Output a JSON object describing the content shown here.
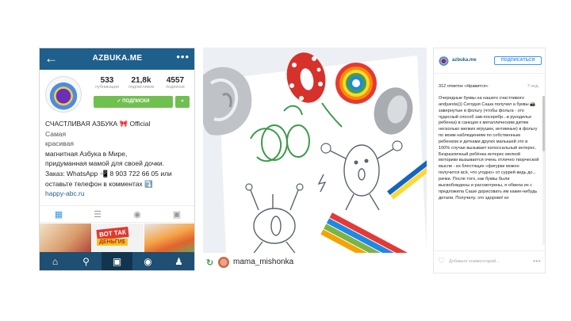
{
  "left_profile": {
    "header": {
      "username": "AZBUKA.ME",
      "back_icon": "arrow-left-icon",
      "more_icon": "more-dots-icon"
    },
    "stats": [
      {
        "value": "533",
        "label": "публикации"
      },
      {
        "value": "21,8k",
        "label": "подписчиков"
      },
      {
        "value": "4557",
        "label": "подписки"
      }
    ],
    "follow_button": "✓ ПОДПИСКИ",
    "bio": {
      "name": "СЧАСТЛИВАЯ АЗБУКА 🎀 Official",
      "line2": "Самая",
      "line3": "красивая",
      "line4": "магнитная Азбука в Мире,",
      "line5": "придуманная мамой для своей дочки.",
      "line6": "Заказ: WhatsApp 📲 8 903 722 66 05 или",
      "line7": "оставьте телефон в комментах ⤵️",
      "link": "happy-abc.ru"
    },
    "thumb2": {
      "line1": "ВОТ ТАК",
      "line2": "ДЕНЬГИ$"
    },
    "accent_color": "#1f5f8b"
  },
  "photo": {
    "repost_user": "mama_mishonka"
  },
  "right_post": {
    "username": "azbuka.me",
    "subscribe_button": "ПОДПИСАТЬСЯ",
    "likes": "312 отметок «Нравится»",
    "time": "7 нед.",
    "text": "Очередные буквы на нашего счастливого andjuesta))) Сегодня Саша получил а буквы 📸 завернутые в фольгу (чтобы фольга - это чудесный способ зав-посеребр...в рукоделье ребенка) в санкция к металлическим дитям несколько мелких игрушек, интимные) в фольгу по моим наблюдениям по собственным ребенком и детками других малышей это в 100% случае вызывает колоссальный интерес. Безразличный ребёнка интерес мелкой моторики вызывается очень отлично творческой мысли - из блестящих «фигурки можно получится всё, что угодно» от суррей ведь до... рачки. После того, как буквы были высвобождены и рассмотрены, я обвела их с предложила Саше дорисовать им какие-нибудь детали. Получилу. это здорово! кн",
    "comment_placeholder": "Добавьте комментарий...",
    "more_label": "•••"
  }
}
